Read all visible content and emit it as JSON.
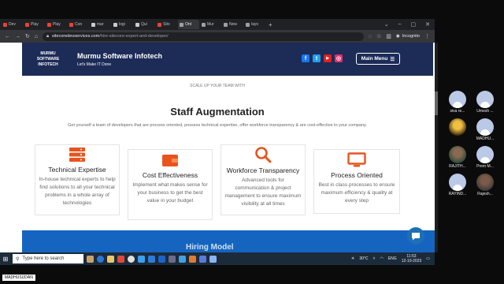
{
  "browser": {
    "tabs": [
      {
        "label": "Dev",
        "color": "#ea4335"
      },
      {
        "label": "Play",
        "color": "#ea4335"
      },
      {
        "label": "Play",
        "color": "#ea4335"
      },
      {
        "label": "Con",
        "color": "#ea4335"
      },
      {
        "label": "mar",
        "color": "#cccccc"
      },
      {
        "label": "logi",
        "color": "#cccccc"
      },
      {
        "label": "Qui",
        "color": "#cccccc"
      },
      {
        "label": "Sito",
        "color": "#ea4335"
      },
      {
        "label": "Ont",
        "color": "#9aa0a6"
      },
      {
        "label": "Mur",
        "color": "#9aa0a6"
      },
      {
        "label": "New",
        "color": "#9aa0a6"
      },
      {
        "label": "layo",
        "color": "#9aa0a6"
      }
    ],
    "active_tab_index": 8,
    "new_tab": "+",
    "url_domain": "sitecoredevservices.com",
    "url_path": "/hire-sitecore-expert-and-developer/",
    "incognito_label": "Incognito"
  },
  "site": {
    "logo_text": [
      "MURMU",
      "SOFTWARE",
      "INFOTECH"
    ],
    "brand_name": "Murmu Software Infotech",
    "tagline": "Let's Make IT Done",
    "social": [
      {
        "name": "facebook-icon",
        "glyph": "f",
        "color": "#1877f2"
      },
      {
        "name": "twitter-icon",
        "glyph": "t",
        "color": "#1da1f2"
      },
      {
        "name": "youtube-icon",
        "glyph": "▶",
        "color": "#e02020"
      },
      {
        "name": "instagram-icon",
        "glyph": "◎",
        "color": "#e1306c"
      }
    ],
    "menu_label": "Main Menu",
    "section_kicker": "SCALE UP YOUR TEAM WITH",
    "section_title": "Staff Augmentation",
    "section_sub": "Get yourself a team of developers that are process oriented, possess technical expertise, offer workforce transparency & are cost-effective to your company.",
    "cards": [
      {
        "title": "Technical Expertise",
        "desc": "In-house technical experts to help find solutions to all your technical problems in a whole array of technologies",
        "icon": "server-icon"
      },
      {
        "title": "Cost Effectiveness",
        "desc": "Implement what makes sense for your business to get the best value in your budget",
        "icon": "wallet-icon"
      },
      {
        "title": "Workforce Transparency",
        "desc": "Advanced tools for communication & project management to ensure maximum visibility at all times",
        "icon": "magnifier-icon"
      },
      {
        "title": "Process Oriented",
        "desc": "Best in class processes to ensure maximum efficiency & quality at every step",
        "icon": "monitor-icon"
      }
    ],
    "accent": "#e8541e",
    "next_section_title": "Hiring Model"
  },
  "taskbar": {
    "search_placeholder": "Type here to search",
    "weather": "30°C",
    "lang": "ENG",
    "time": "11:53",
    "date": "12-10-2023"
  },
  "meeting": {
    "presenter_name": "MADHUSUDAN",
    "participants": [
      {
        "name": "siva re...",
        "photo": false
      },
      {
        "name": "Umesh ...",
        "photo": false
      },
      {
        "name": "",
        "photo": true
      },
      {
        "name": "MADHU...",
        "photo": false
      },
      {
        "name": "RAJITH...",
        "photo": true
      },
      {
        "name": "Prem M...",
        "photo": false
      },
      {
        "name": "RAYIND...",
        "photo": false
      },
      {
        "name": "Rajesh...",
        "photo": true
      }
    ]
  }
}
